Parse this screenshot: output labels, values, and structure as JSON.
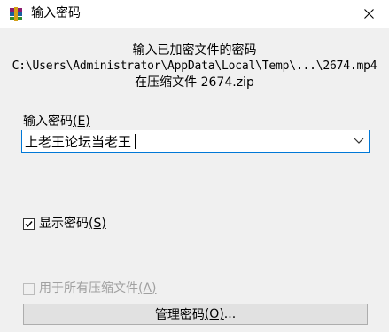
{
  "window": {
    "title": "输入密码",
    "app_icon": "winrar-icon",
    "close_icon": "close-icon"
  },
  "info": {
    "line1": "输入已加密文件的密码",
    "line2": "C:\\Users\\Administrator\\AppData\\Local\\Temp\\...\\2674.mp4",
    "line3": "在压缩文件 2674.zip"
  },
  "password": {
    "label": "输入密码",
    "accel": "(E)",
    "value": "上老王论坛当老王",
    "dropdown_icon": "chevron-down-icon"
  },
  "show_password": {
    "label": "显示密码",
    "accel": "(S)",
    "checked": true
  },
  "all_archives": {
    "label": "用于所有压缩文件",
    "accel": "(A)",
    "checked": false,
    "enabled": false
  },
  "manage_button": {
    "label": "管理密码",
    "accel": "(O)",
    "suffix": "..."
  }
}
